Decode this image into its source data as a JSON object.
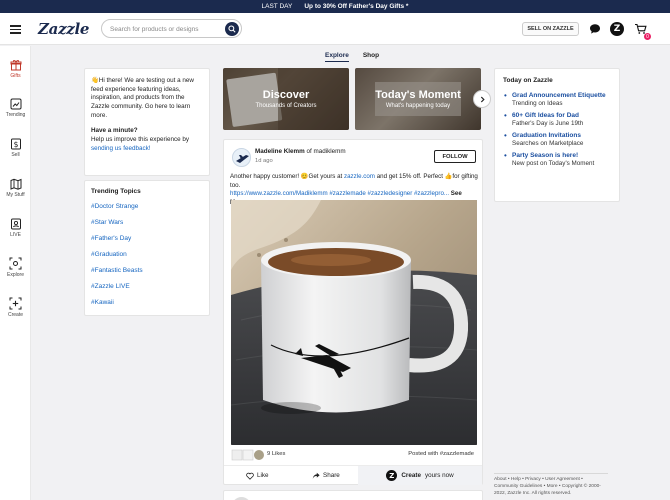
{
  "promo": {
    "lead": "LAST DAY",
    "offer": "Up to 30% Off Father's Day Gifts *"
  },
  "header": {
    "logo": "Zazzle",
    "search_placeholder": "Search for products or designs",
    "sell_label": "SELL ON ZAZZLE",
    "cart_count": "0"
  },
  "sidebar": {
    "items": [
      {
        "label": "Gifts",
        "icon": "gift-icon"
      },
      {
        "label": "Trending",
        "icon": "trending-icon"
      },
      {
        "label": "Sell",
        "icon": "dollar-icon"
      },
      {
        "label": "My Stuff",
        "icon": "map-icon"
      },
      {
        "label": "LIVE",
        "icon": "live-icon"
      },
      {
        "label": "Explore",
        "icon": "explore-icon"
      },
      {
        "label": "Create",
        "icon": "create-icon"
      }
    ]
  },
  "feed_tabs": [
    {
      "label": "Explore",
      "active": true
    },
    {
      "label": "Shop",
      "active": false
    }
  ],
  "welcome": {
    "intro": "Hi there! We are testing out a new feed experience featuring ideas, inspiration, and products from the Zazzle community. Go here to learn more.",
    "question_title": "Have a minute?",
    "question_text": "Help us improve this experience by",
    "feedback_link": "sending us feedback!"
  },
  "trending": {
    "title": "Trending Topics",
    "topics": [
      "#Doctor Strange",
      "#Star Wars",
      "#Father's Day",
      "#Graduation",
      "#Fantastic Beasts",
      "#Zazzle LIVE",
      "#Kawaii"
    ]
  },
  "heroes": [
    {
      "title": "Discover",
      "subtitle": "Thousands of Creators"
    },
    {
      "title": "Today's Moment",
      "subtitle": "What's happening today"
    }
  ],
  "post": {
    "author": "Madeline Klemm",
    "handle_prefix": "of",
    "handle": "madiklemm",
    "time": "1d ago",
    "follow_label": "FOLLOW",
    "caption_start": "Another happy customer! 😊Get yours at",
    "caption_link": "zazzle.com",
    "caption_end": "and get 15% off. Perfect 👍for gifting too.",
    "caption_url": "https://www.zazzle.com/Madiklemm #zazzlemade #zazzledesigner #zazzlepro...",
    "see_more": "See More",
    "likes": "9 Likes",
    "posted_with": "Posted with #zazzlemade",
    "like_label": "Like",
    "share_label": "Share",
    "create_bold": "Create",
    "create_rest": "yours now"
  },
  "today": {
    "title": "Today on Zazzle",
    "items": [
      {
        "title": "Grad Announcement Etiquette",
        "sub": "Trending on Ideas"
      },
      {
        "title": "60+ Gift Ideas for Dad",
        "sub": "Father's Day is June 19th"
      },
      {
        "title": "Graduation Invitations",
        "sub": "Searches on Marketplace"
      },
      {
        "title": "Party Season is here!",
        "sub": "New post on Today's Moment"
      }
    ]
  },
  "footer": {
    "line1": "About • Help • Privacy • User Agreement •",
    "line2": "Community Guidelines • More • Copyright © 2000-",
    "line3": "2022, Zazzle Inc. All rights reserved."
  },
  "colors": {
    "brand": "#1b2a4e",
    "link": "#1565c0",
    "promo_bg": "#1b2a4e",
    "badge": "#e91e63"
  }
}
